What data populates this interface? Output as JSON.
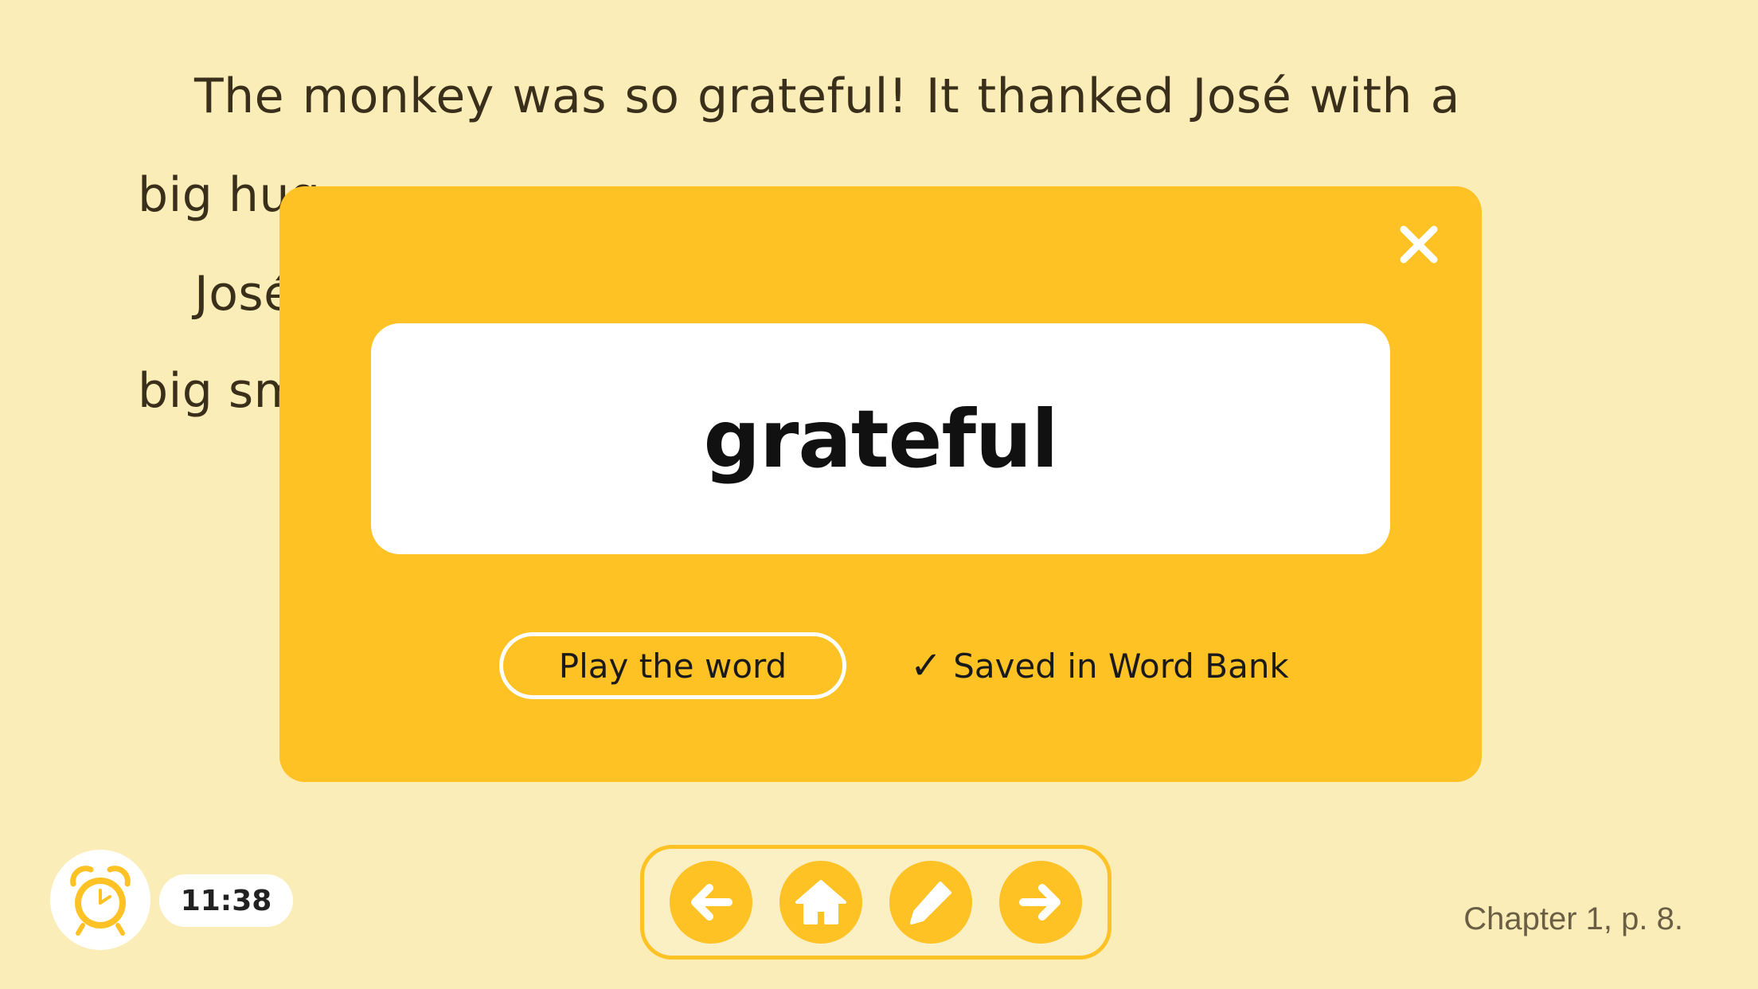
{
  "story": {
    "line1_words": [
      "The",
      "monkey",
      "was",
      "so",
      "grateful!",
      "It",
      "thanked",
      "José",
      "with",
      "a"
    ],
    "line2": "big hug",
    "line3": "José",
    "line4": "big sm"
  },
  "modal": {
    "word": "grateful",
    "play_label": "Play the word",
    "saved_check": "✓",
    "saved_label": "Saved in Word Bank",
    "close_icon": "close-icon"
  },
  "bottom": {
    "timer": "11:38",
    "alarm_icon": "alarm-clock-icon",
    "nav": [
      {
        "name": "previous-page-button",
        "icon": "arrow-left-icon"
      },
      {
        "name": "home-button",
        "icon": "home-icon"
      },
      {
        "name": "edit-button",
        "icon": "pencil-icon"
      },
      {
        "name": "next-page-button",
        "icon": "arrow-right-icon"
      }
    ],
    "page_indicator": "Chapter 1, p. 8."
  },
  "colors": {
    "background": "#FAEDB8",
    "accent": "#FEC225",
    "card": "#FFFFFF",
    "text": "#3A2F1A"
  }
}
